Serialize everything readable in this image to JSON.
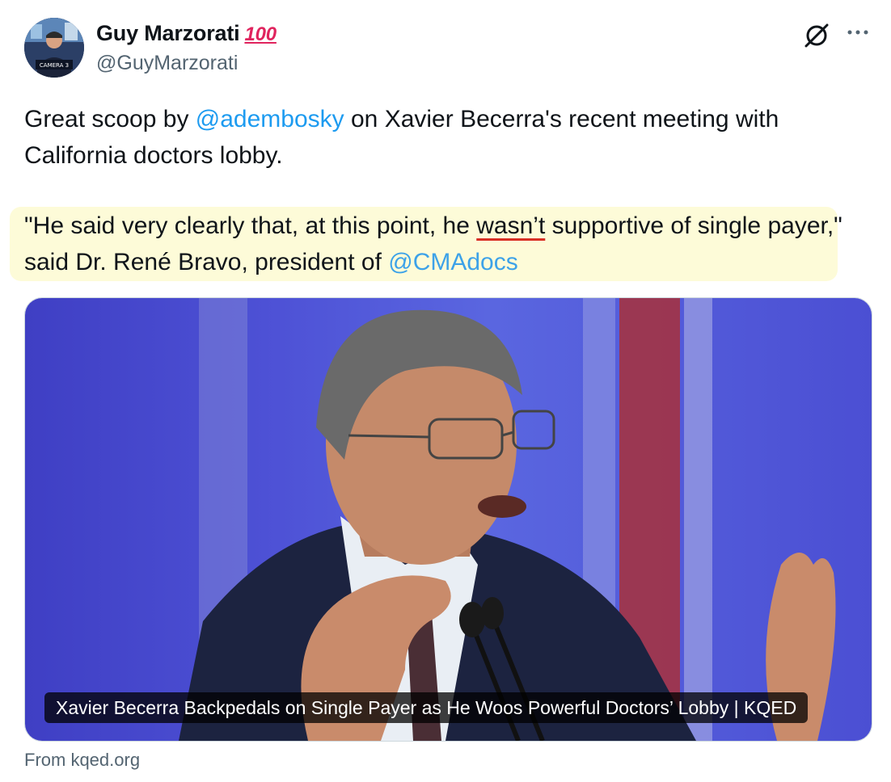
{
  "author": {
    "display_name": "Guy Marzorati",
    "emoji": "100",
    "handle": "@GuyMarzorati",
    "avatar_label": "CAMERA 3"
  },
  "tweet": {
    "text_parts": [
      "Great scoop by ",
      "@adembosky",
      " on Xavier Becerra's recent meeting with California doctors lobby."
    ],
    "quote_parts": [
      "\"He said very clearly that, at this point, he ",
      "wasn’t",
      " supportive of single payer,\" said Dr. René Bravo, president of ",
      "@CMAdocs"
    ]
  },
  "card": {
    "title": "Xavier Becerra Backpedals on Single Payer as He Woos Powerful Doctors’ Lobby | KQED",
    "source": "From kqed.org"
  },
  "icons": [
    "grok-icon",
    "more-icon"
  ],
  "colors": {
    "link": "#1d9bf0",
    "highlight": "#fdfbd8"
  }
}
